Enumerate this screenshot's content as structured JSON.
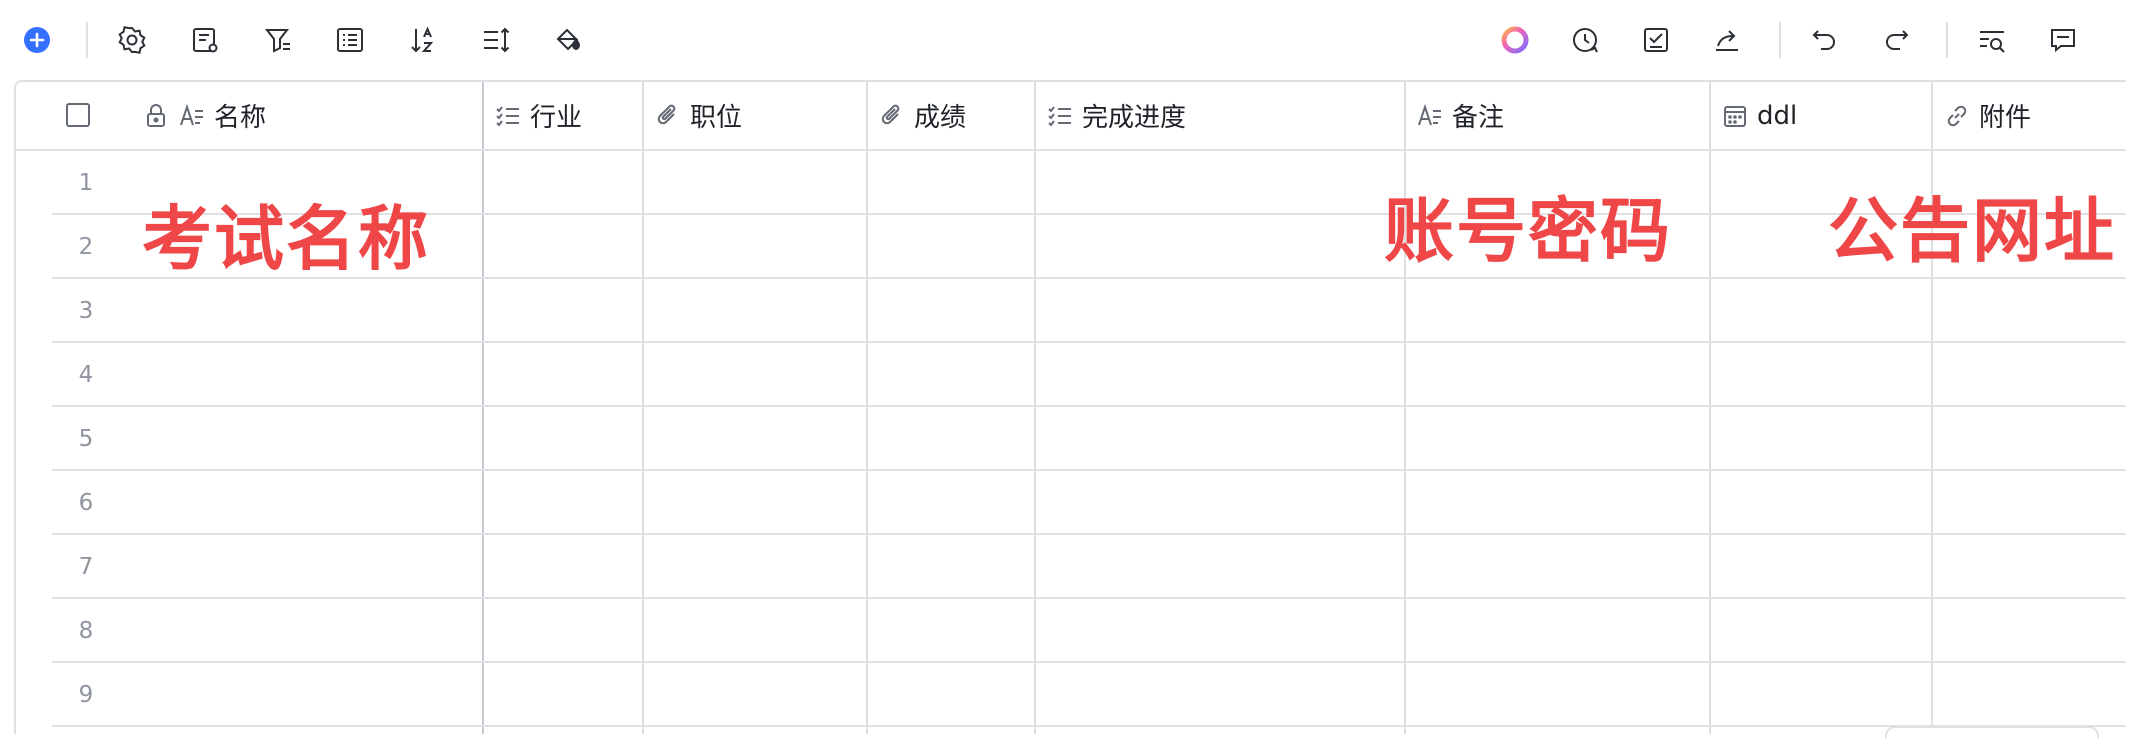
{
  "toolbar": {
    "left_icons": [
      "add-record-icon",
      "settings-gear-icon",
      "field-settings-icon",
      "filter-icon",
      "group-list-icon",
      "sort-az-icon",
      "row-height-icon",
      "fill-color-icon"
    ],
    "right_icons": [
      "ai-assistant-icon",
      "history-clock-icon",
      "checklist-icon",
      "share-icon",
      "undo-icon",
      "redo-icon",
      "search-icon",
      "comment-icon"
    ]
  },
  "columns": [
    {
      "label": "名称",
      "icon": "text-icon",
      "locked": true
    },
    {
      "label": "行业",
      "icon": "multi-select-icon"
    },
    {
      "label": "职位",
      "icon": "attachment-icon"
    },
    {
      "label": "成绩",
      "icon": "attachment-icon"
    },
    {
      "label": "完成进度",
      "icon": "multi-select-icon"
    },
    {
      "label": "备注",
      "icon": "text-icon"
    },
    {
      "label": "ddl",
      "icon": "calendar-icon"
    },
    {
      "label": "附件",
      "icon": "link-icon"
    }
  ],
  "rows": [
    "1",
    "2",
    "3",
    "4",
    "5",
    "6",
    "7",
    "8",
    "9"
  ],
  "annotations": {
    "exam_name": "考试名称",
    "account_password": "账号密码",
    "announcement_url": "公告网址"
  },
  "colors": {
    "accent_blue": "#3370ff",
    "annotation_red": "#ef4648",
    "border": "#dee0e3"
  }
}
